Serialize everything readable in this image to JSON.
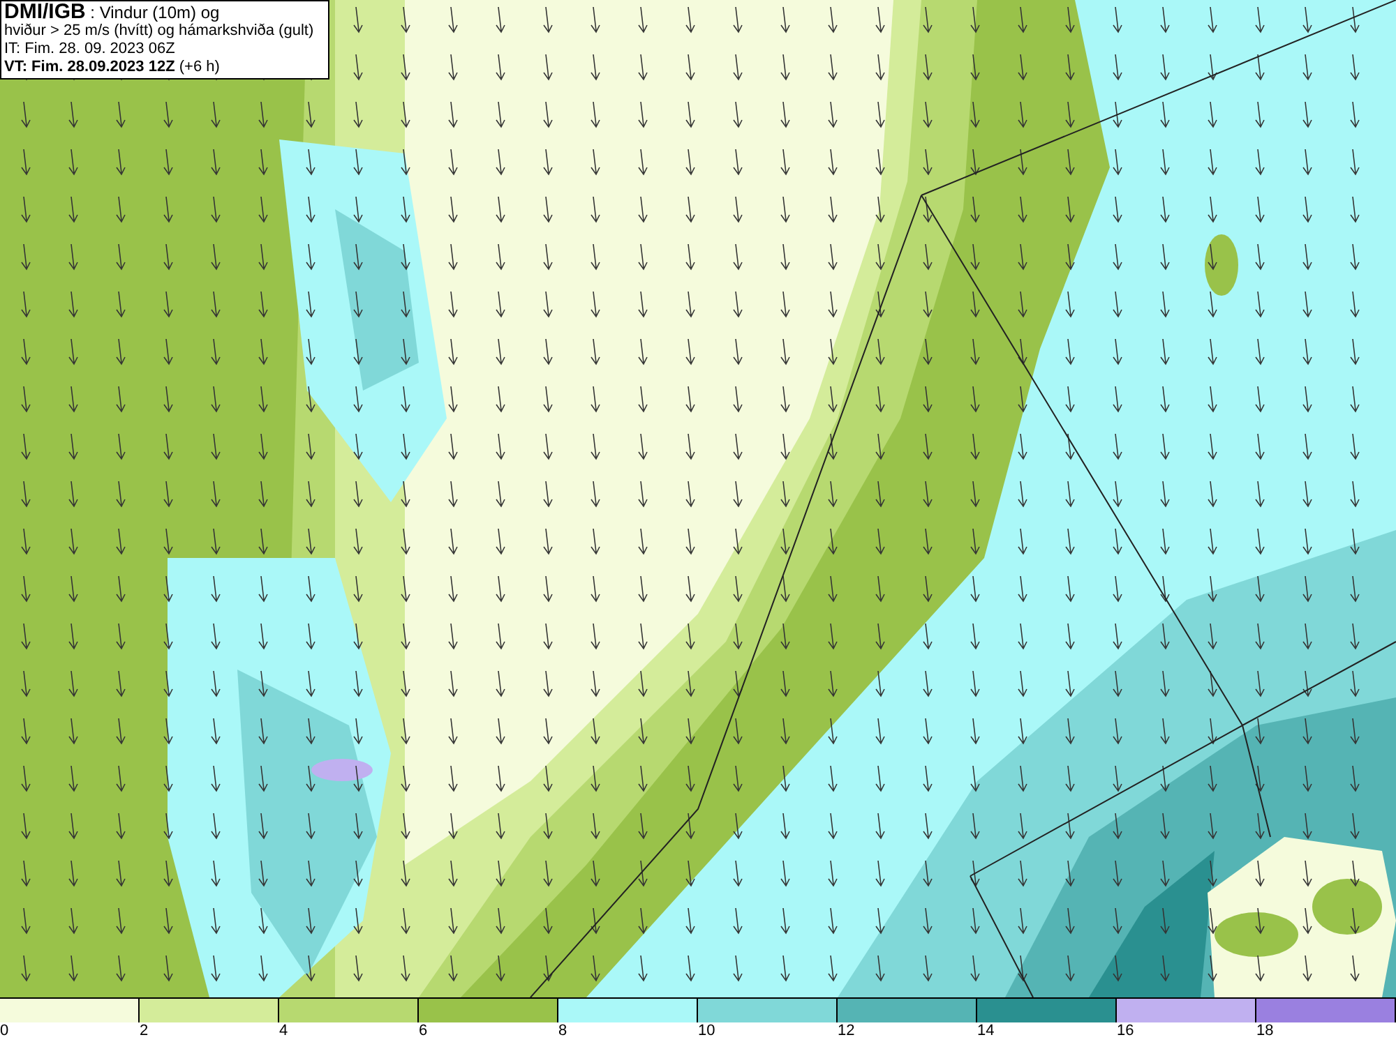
{
  "header": {
    "lines": [
      "**DMI/IGB** : Vindur (10m) og",
      "hviður > 25 m/s (hvítt) og hámarkshviða (gult)",
      "IT: Fim. 28. 09. 2023 06Z",
      "**VT: Fim. 28.09.2023 12Z** (+6 h)"
    ]
  },
  "legend": [
    {
      "color": "#f5fbdc",
      "label": "0"
    },
    {
      "color": "#d4ec9a",
      "label": "2"
    },
    {
      "color": "#b7d970",
      "label": "4"
    },
    {
      "color": "#99c24a",
      "label": "6"
    },
    {
      "color": "#aaf8f8",
      "label": "8"
    },
    {
      "color": "#80d8d8",
      "label": "10"
    },
    {
      "color": "#55b4b4",
      "label": "12"
    },
    {
      "color": "#2a9090",
      "label": "14"
    },
    {
      "color": "#c0b0f0",
      "label": "16"
    },
    {
      "color": "#9a80e0",
      "label": "18"
    }
  ]
}
